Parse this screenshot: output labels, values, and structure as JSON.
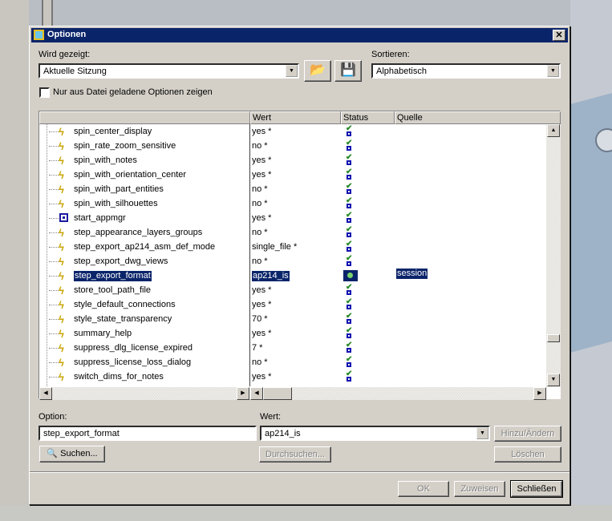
{
  "window": {
    "title": "Optionen",
    "close": "✕"
  },
  "shown": {
    "label": "Wird gezeigt:",
    "value": "Aktuelle Sitzung"
  },
  "sort": {
    "label": "Sortieren:",
    "value": "Alphabetisch"
  },
  "checkbox": {
    "label": "Nur aus Datei geladene Optionen zeigen",
    "checked": false
  },
  "columns": {
    "name": "",
    "value": "Wert",
    "status": "Status",
    "source": "Quelle"
  },
  "rows": [
    {
      "name": "spin_center_display",
      "value": "yes *",
      "icon": "bolt"
    },
    {
      "name": "spin_rate_zoom_sensitive",
      "value": "no *",
      "icon": "bolt"
    },
    {
      "name": "spin_with_notes",
      "value": "yes *",
      "icon": "bolt"
    },
    {
      "name": "spin_with_orientation_center",
      "value": "yes *",
      "icon": "bolt"
    },
    {
      "name": "spin_with_part_entities",
      "value": "no *",
      "icon": "bolt"
    },
    {
      "name": "spin_with_silhouettes",
      "value": "no *",
      "icon": "bolt"
    },
    {
      "name": "start_appmgr",
      "value": "yes *",
      "icon": "app"
    },
    {
      "name": "step_appearance_layers_groups",
      "value": "no *",
      "icon": "bolt"
    },
    {
      "name": "step_export_ap214_asm_def_mode",
      "value": "single_file *",
      "icon": "bolt"
    },
    {
      "name": "step_export_dwg_views",
      "value": "no *",
      "icon": "bolt"
    },
    {
      "name": "step_export_format",
      "value": "ap214_is",
      "icon": "bolt",
      "selected": true,
      "source": "session"
    },
    {
      "name": "store_tool_path_file",
      "value": "yes *",
      "icon": "bolt"
    },
    {
      "name": "style_default_connections",
      "value": "yes *",
      "icon": "bolt"
    },
    {
      "name": "style_state_transparency",
      "value": "70 *",
      "icon": "bolt"
    },
    {
      "name": "summary_help",
      "value": "yes *",
      "icon": "bolt"
    },
    {
      "name": "suppress_dlg_license_expired",
      "value": "7 *",
      "icon": "bolt"
    },
    {
      "name": "suppress_license_loss_dialog",
      "value": "no *",
      "icon": "bolt"
    },
    {
      "name": "switch_dims_for_notes",
      "value": "yes *",
      "icon": "bolt"
    }
  ],
  "option": {
    "label": "Option:",
    "value": "step_export_format"
  },
  "wert": {
    "label": "Wert:",
    "value": "ap214_is"
  },
  "buttons": {
    "add": "Hinzu/Ändern",
    "search": "Suchen...",
    "browse": "Durchsuchen...",
    "delete": "Löschen",
    "ok": "OK",
    "apply": "Zuweisen",
    "close": "Schließen"
  }
}
